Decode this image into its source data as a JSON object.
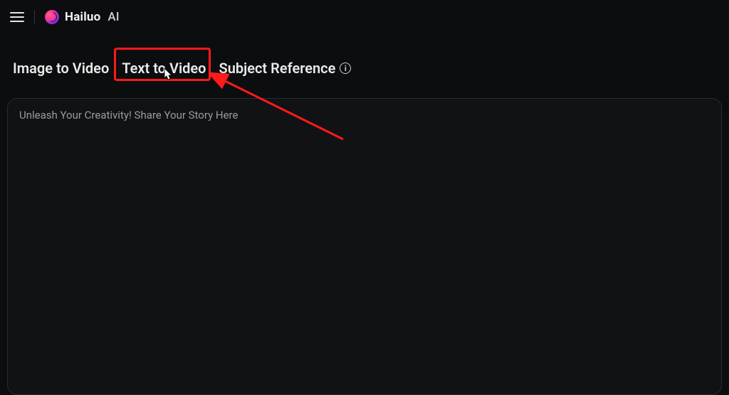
{
  "brand": {
    "name": "Hailuo",
    "suffix": "AI"
  },
  "tabs": {
    "image_to_video": "Image to Video",
    "text_to_video": "Text to Video",
    "subject_reference": "Subject Reference"
  },
  "editor": {
    "placeholder": "Unleash Your Creativity! Share Your Story Here"
  },
  "annotation": {
    "highlight_color": "#ff1a1a"
  }
}
